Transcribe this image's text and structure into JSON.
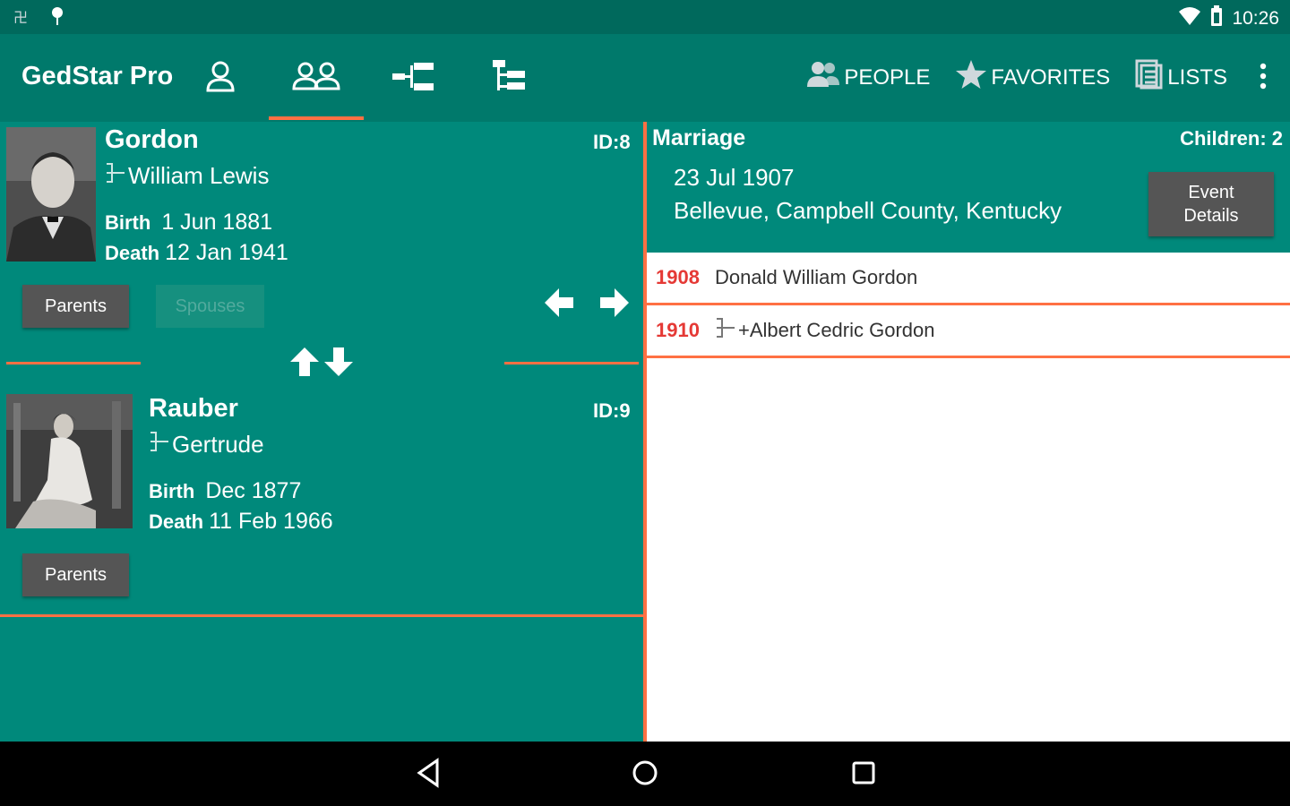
{
  "status": {
    "time": "10:26"
  },
  "appbar": {
    "title": "GedStar Pro",
    "tabs": [
      {
        "icon": "person-icon"
      },
      {
        "icon": "couple-icon",
        "selected": true
      },
      {
        "icon": "pedigree-icon"
      },
      {
        "icon": "descendant-tree-icon"
      }
    ],
    "actions": {
      "people": "PEOPLE",
      "favorites": "FAVORITES",
      "lists": "LISTS"
    }
  },
  "husband": {
    "surname": "Gordon",
    "given": "William Lewis",
    "id_label": "ID:8",
    "birth_label": "Birth",
    "birth_value": "1 Jun 1881",
    "death_label": "Death",
    "death_value": "12 Jan 1941",
    "parents_button": "Parents",
    "spouses_button": "Spouses"
  },
  "wife": {
    "surname": "Rauber",
    "given": "Gertrude",
    "id_label": "ID:9",
    "birth_label": "Birth",
    "birth_value": "Dec 1877",
    "death_label": "Death",
    "death_value": "11 Feb 1966",
    "parents_button": "Parents"
  },
  "marriage": {
    "title": "Marriage",
    "children_label": "Children: 2",
    "date": "23 Jul 1907",
    "place": "Bellevue, Campbell County, Kentucky",
    "event_details_line1": "Event",
    "event_details_line2": "Details"
  },
  "children": [
    {
      "year": "1908",
      "name": "Donald William Gordon",
      "has_family": false
    },
    {
      "year": "1910",
      "name": "+Albert Cedric Gordon",
      "has_family": true
    }
  ]
}
